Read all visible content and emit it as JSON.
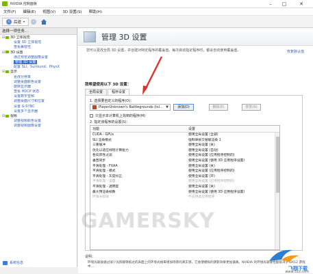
{
  "window": {
    "title": "NVIDIA 控制面板",
    "min": "–",
    "max": "□",
    "close": "✕"
  },
  "menubar": [
    "文件(F)",
    "编辑(E)",
    "视图(V)",
    "3D 设置(S)",
    "帮助(H)"
  ],
  "toolbar": {
    "back_label": "后退"
  },
  "sidebar": {
    "header": "选择一项任务...",
    "tree": [
      {
        "type": "cat",
        "label": "3D 立体视觉"
      },
      {
        "type": "item",
        "label": "设置 3D 立体视觉"
      },
      {
        "type": "item",
        "label": "查看兼容性"
      },
      {
        "type": "cat",
        "label": "3D 设置"
      },
      {
        "type": "item",
        "label": "通过预览调整图像设置"
      },
      {
        "type": "item",
        "label": "管理 3D 设置",
        "selected": true
      },
      {
        "type": "item",
        "label": "配置 SLI、Surround、PhysX"
      },
      {
        "type": "cat",
        "label": "显示"
      },
      {
        "type": "item",
        "label": "更改分辨率"
      },
      {
        "type": "item",
        "label": "调整桌面颜色设置"
      },
      {
        "type": "item",
        "label": "旋转显示器"
      },
      {
        "type": "item",
        "label": "查看 HDCP 状态"
      },
      {
        "type": "item",
        "label": "设置数字音频"
      },
      {
        "type": "item",
        "label": "调整桌面尺寸和位置"
      },
      {
        "type": "item",
        "label": "设置 G-SYNC"
      },
      {
        "type": "item",
        "label": "设置多个显示器"
      },
      {
        "type": "cat",
        "label": "视频"
      },
      {
        "type": "item",
        "label": "调整视频颜色设置"
      },
      {
        "type": "item",
        "label": "调整视频图像设置"
      }
    ],
    "footer": "系统信息"
  },
  "main": {
    "title": "管理 3D 设置",
    "description": "您可以更改全局 3D 设置，并创建对特定程序的覆盖值。每次启动指定程序时，都会自动使用覆盖值。",
    "restore_link": "恢复默认值",
    "section_label": "我希望使用以下 3D 设置：",
    "tabs": [
      "全局设置",
      "程序设置"
    ],
    "select_label": "1. 选择要自定义的程序(O)：",
    "program": "PlayerUnknown's Battlegrounds (tsl...",
    "add_button": "添加(D)",
    "remove_button": "删除(E)",
    "restore_button": "恢复(R)",
    "checkbox_label": "只显示本计算机上找到的程序(M)",
    "settings_label": "2. 指定该程序的设置(S)：",
    "table_headers": [
      "功能",
      "设置"
    ],
    "table_rows": [
      {
        "feature": "CUDA - GPUs",
        "setting": "使用全局设置 (全部)"
      },
      {
        "feature": "SLI 渲染模式",
        "setting": "强制单帧交替输渲染 1"
      },
      {
        "feature": "三重缓冲",
        "setting": "使用全局设置 (关)"
      },
      {
        "feature": "优化以适应线程计算能力",
        "setting": "使用全局设置 (自动)"
      },
      {
        "feature": "各向异性过滤",
        "setting": "使用全局设置 (应用程序控制的)"
      },
      {
        "feature": "垂直同步",
        "setting": "使用全局设置 (使用 3D 应用程序设置)"
      },
      {
        "feature": "平滑处理 - FXAA",
        "setting": "使用全局设置 (关)"
      },
      {
        "feature": "平滑处理 - 模式",
        "setting": "使用全局设置 (应用程序控制的)"
      },
      {
        "feature": "平滑处理 - 灰度纠正",
        "setting": "使用全局设置 (开)"
      },
      {
        "feature": "平滑处理 - 设置",
        "setting": "使用全局设置 (应用程序控制的)",
        "faded": true
      },
      {
        "feature": "平滑处理 - 透明度",
        "setting": "使用全局设置 (关)"
      },
      {
        "feature": "最大预渲染帧数",
        "setting": "使用全局设置 (使用 3D 应用程序设置)"
      },
      {
        "feature": "环境光吸收",
        "setting": "不支持此应用程序",
        "faded": true
      }
    ],
    "desc_title": "说明：",
    "desc_text": "环境光吸收通过减少光照能够抵达的表面上的环境光线来增加场景的真实感。它会使模拟的阴影效果更加逼真。NVIDIA 的环境光吸收性能取决于 DX12 游戏中..."
  },
  "watermark": "GAMERSKY",
  "site": {
    "name": "飞翔下载",
    "url": "www.52z.com"
  }
}
